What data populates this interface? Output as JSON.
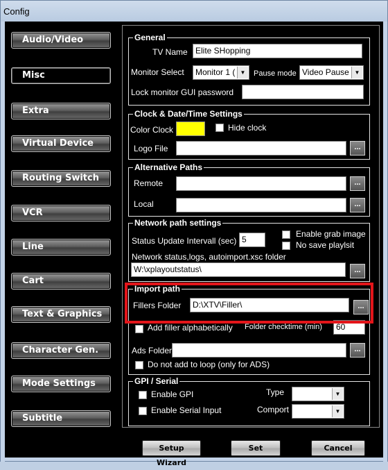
{
  "window": {
    "title": "Config"
  },
  "nav": {
    "items": [
      {
        "label": "Audio/Video"
      },
      {
        "label": "Misc"
      },
      {
        "label": "Extra"
      },
      {
        "label": "Virtual Device"
      },
      {
        "label": "Routing Switch"
      },
      {
        "label": "VCR"
      },
      {
        "label": "Line"
      },
      {
        "label": "Cart"
      },
      {
        "label": "Text & Graphics"
      },
      {
        "label": "Character Gen."
      },
      {
        "label": "Mode Settings"
      },
      {
        "label": "Subtitle"
      }
    ],
    "active_index": 1
  },
  "general": {
    "title": "General",
    "tv_name_label": "TV Name",
    "tv_name_value": "Elite SHopping",
    "monitor_select_label": "Monitor Select",
    "monitor_select_value": "Monitor 1 (",
    "pause_mode_label": "Pause mode",
    "pause_mode_value": "Video Pause",
    "lock_label": "Lock monitor GUI password",
    "lock_value": ""
  },
  "clock": {
    "title": "Clock & Date/Time Settings",
    "color_clock_label": "Color Clock",
    "color_clock_color": "#ffff00",
    "hide_clock_label": "Hide clock",
    "logo_file_label": "Logo File",
    "logo_file_value": ""
  },
  "alt_paths": {
    "title": "Alternative Paths",
    "remote_label": "Remote",
    "local_label": "Local"
  },
  "network": {
    "title": "Network path settings",
    "status_interval_label": "Status Update Intervall (sec)",
    "status_interval_value": "5",
    "enable_grab_label": "Enable grab image",
    "no_save_label": "No save playlsit",
    "folder_label": "Network status,logs, autoimport.xsc folder",
    "folder_value": "W:\\xplayoutstatus\\"
  },
  "import": {
    "title": "Import path",
    "fillers_label": "Fillers Folder",
    "fillers_value": "D:\\XTV\\Filler\\",
    "add_filler_label": "Add filler alphabetically",
    "checktime_label": "Folder checktime (min)",
    "checktime_value": "60",
    "ads_label": "Ads Folder",
    "no_loop_label": "Do not add to loop (only for ADS)"
  },
  "gpi": {
    "title": "GPI / Serial",
    "enable_gpi_label": "Enable GPI",
    "enable_serial_label": "Enable Serial Input",
    "type_label": "Type",
    "comport_label": "Comport"
  },
  "buttons": {
    "dots": "...",
    "setup_wizard": "Setup Wizard",
    "set": "Set",
    "cancel": "Cancel"
  },
  "colors": {
    "highlight": "#e3151a"
  }
}
